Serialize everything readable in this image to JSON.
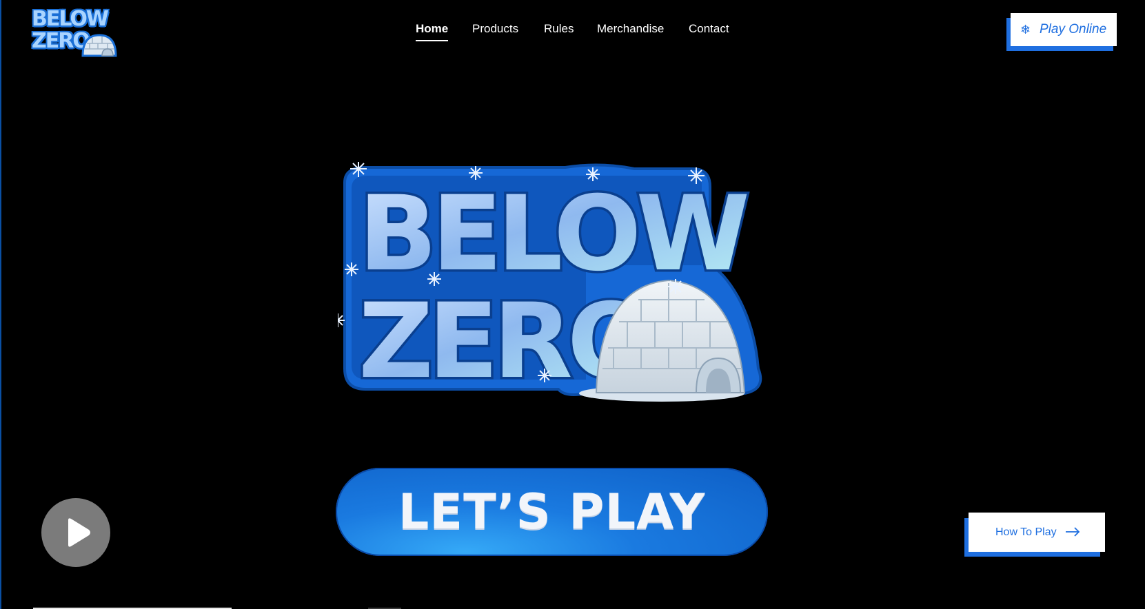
{
  "header": {
    "logo_line1": "BELOW",
    "logo_line2": "ZERO",
    "nav": [
      {
        "label": "Home",
        "active": true
      },
      {
        "label": "Products",
        "active": false
      },
      {
        "label": "Rules",
        "active": false
      },
      {
        "label": "Merchandise",
        "active": false
      },
      {
        "label": "Contact",
        "active": false
      }
    ],
    "cta": {
      "icon": "snowflake-icon",
      "label": "Play Online"
    }
  },
  "hero": {
    "logo_line1": "BELOW",
    "logo_line2": "ZERO",
    "button_label": "LET’S PLAY"
  },
  "video": {
    "icon": "play-icon"
  },
  "how_to_play": {
    "label": "How To Play",
    "icon": "arrow-right-icon"
  },
  "colors": {
    "background": "#000000",
    "accent_blue": "#1f6fe0",
    "button_white": "#ffffff"
  }
}
